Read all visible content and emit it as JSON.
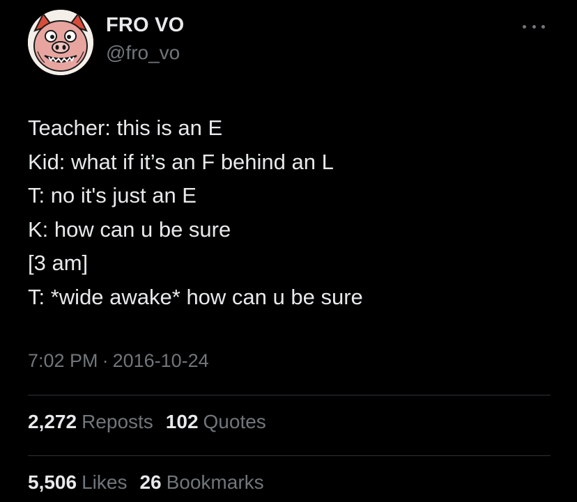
{
  "author": {
    "display_name": "FRO VO",
    "handle": "@fro_vo",
    "avatar_icon": "pig-face-avatar"
  },
  "tweet": {
    "lines": [
      "Teacher: this is an E",
      "Kid: what if it’s an F behind an L",
      "T: no it's just an E",
      "K: how can u be sure",
      "[3 am]",
      "T: *wide awake* how can u be sure"
    ],
    "time": "7:02 PM",
    "separator": "·",
    "date": "2016-10-24"
  },
  "stats": {
    "reposts": {
      "count": "2,272",
      "label": "Reposts"
    },
    "quotes": {
      "count": "102",
      "label": "Quotes"
    },
    "likes": {
      "count": "5,506",
      "label": "Likes"
    },
    "bookmarks": {
      "count": "26",
      "label": "Bookmarks"
    }
  },
  "colors": {
    "background": "#000000",
    "primary_text": "#e7e9ea",
    "secondary_text": "#71767b",
    "divider": "#2f3336"
  }
}
